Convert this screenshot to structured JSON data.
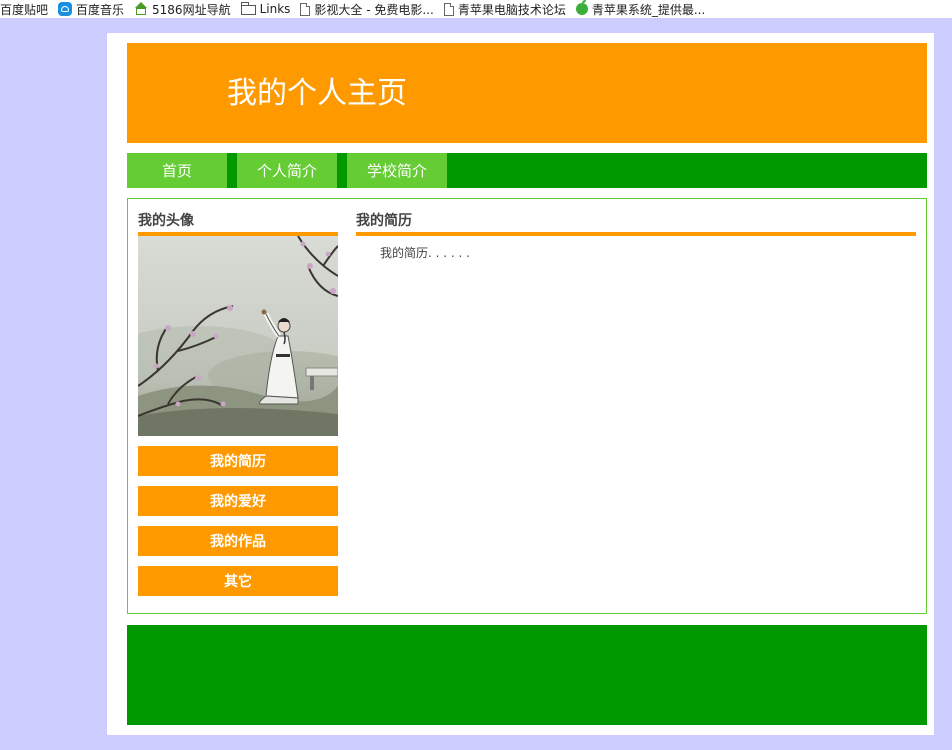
{
  "bookmarks": [
    {
      "label": "百度贴吧",
      "icon": "tieba-icon"
    },
    {
      "label": "百度音乐",
      "icon": "music-icon"
    },
    {
      "label": "5186网址导航",
      "icon": "home-icon"
    },
    {
      "label": "Links",
      "icon": "folder-icon"
    },
    {
      "label": "影视大全 - 免费电影...",
      "icon": "page-icon"
    },
    {
      "label": "青苹果电脑技术论坛",
      "icon": "page-icon"
    },
    {
      "label": "青苹果系统_提供最...",
      "icon": "apple-icon"
    }
  ],
  "header": {
    "title": "我的个人主页"
  },
  "nav": {
    "items": [
      "首页",
      "个人简介",
      "学校简介"
    ]
  },
  "sidebar": {
    "avatar_heading": "我的头像",
    "buttons": [
      "我的简历",
      "我的爱好",
      "我的作品",
      "其它"
    ]
  },
  "main": {
    "heading": "我的简历",
    "text": "我的简历. . . . . ."
  },
  "colors": {
    "page_background": "#ccccff",
    "orange": "#ff9900",
    "dark_green": "#009900",
    "light_green": "#66cc33"
  }
}
